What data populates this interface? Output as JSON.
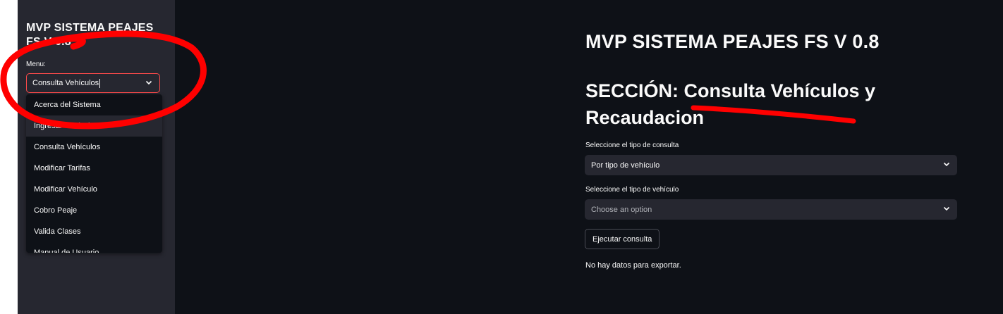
{
  "sidebar": {
    "title": "MVP SISTEMA PEAJES FS V 0.8",
    "menu_label": "Menu:",
    "selected": "Consulta Vehículos",
    "options": [
      "Acerca del Sistema",
      "Ingresar Vehículos",
      "Consulta Vehículos",
      "Modificar Tarifas",
      "Modificar Vehículo",
      "Cobro Peaje",
      "Valida Clases",
      "Manual de Usuario"
    ]
  },
  "main": {
    "title": "MVP SISTEMA PEAJES FS V 0.8",
    "section": "SECCIÓN: Consulta Vehículos y Recaudacion",
    "query_type_label": "Seleccione el tipo de consulta",
    "query_type_value": "Por tipo de vehículo",
    "vehicle_type_label": "Seleccione el tipo de vehículo",
    "vehicle_type_placeholder": "Choose an option",
    "run_button": "Ejecutar consulta",
    "empty_message": "No hay datos para exportar."
  },
  "colors": {
    "sidebar_bg": "#262730",
    "main_bg": "#0e1117",
    "accent": "#ff4b4b",
    "annotation": "#ff0000"
  },
  "icons": {
    "dropdown": "chevron-down-icon"
  }
}
